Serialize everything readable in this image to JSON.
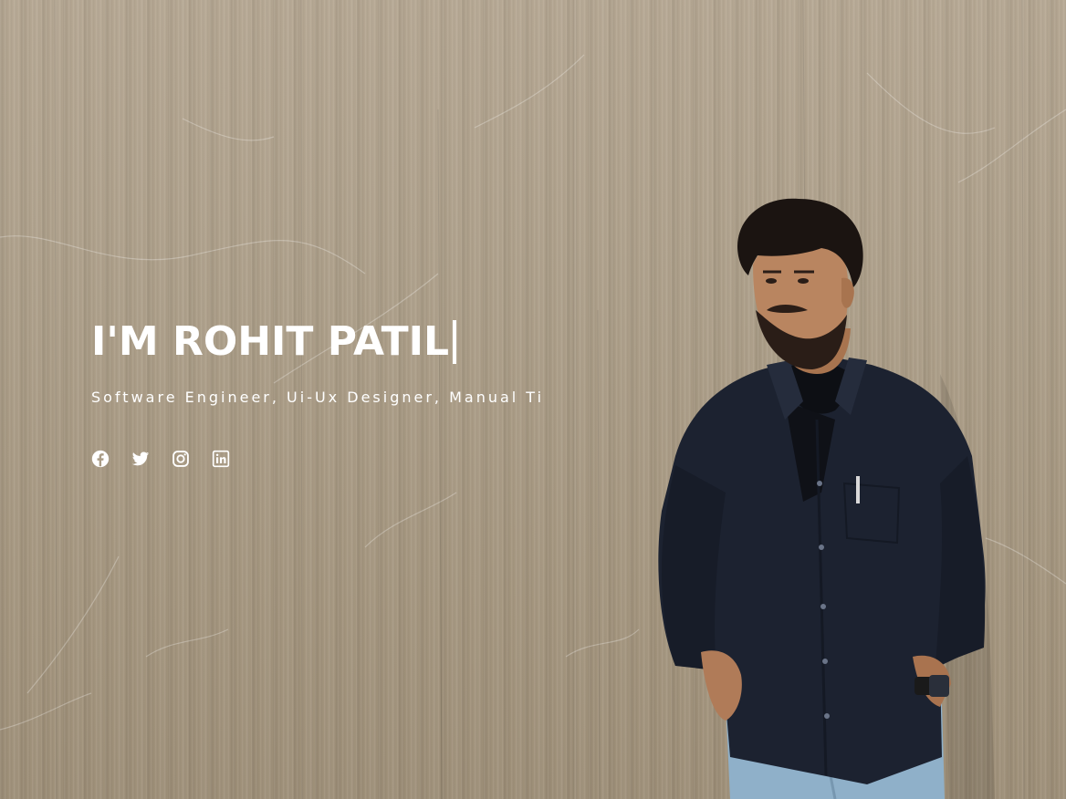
{
  "hero": {
    "title": "I'M ROHIT PATIL",
    "subtitle": "Software Engineer, Ui-Ux Designer, Manual Ti",
    "text_color": "#ffffff",
    "background_color": "#ab9d87"
  },
  "social": {
    "items": [
      {
        "icon": "facebook-icon"
      },
      {
        "icon": "twitter-icon"
      },
      {
        "icon": "instagram-icon"
      },
      {
        "icon": "linkedin-icon"
      }
    ]
  }
}
